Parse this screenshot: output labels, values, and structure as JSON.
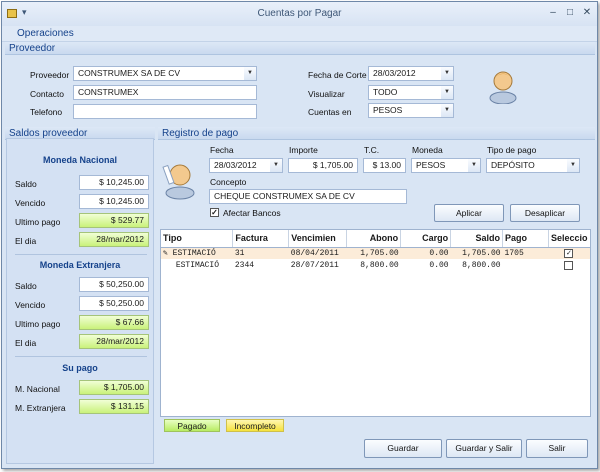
{
  "window": {
    "title": "Cuentas por Pagar"
  },
  "menu": {
    "operaciones": "Operaciones"
  },
  "proveedor": {
    "header": "Proveedor",
    "proveedor_label": "Proveedor",
    "proveedor_value": "CONSTRUMEX SA DE CV",
    "contacto_label": "Contacto",
    "contacto_value": "CONSTRUMEX",
    "telefono_label": "Telefono",
    "telefono_value": "",
    "fecha_corte_label": "Fecha de Corte",
    "fecha_corte_value": "28/03/2012",
    "visualizar_label": "Visualizar",
    "visualizar_value": "TODO",
    "cuentas_en_label": "Cuentas en",
    "cuentas_en_value": "PESOS"
  },
  "saldos": {
    "header": "Saldos proveedor",
    "moneda_nacional": {
      "title": "Moneda Nacional",
      "saldo_label": "Saldo",
      "saldo": "$ 10,245.00",
      "vencido_label": "Vencido",
      "vencido": "$ 10,245.00",
      "ultimo_pago_label": "Ultimo pago",
      "ultimo_pago": "$ 529.77",
      "el_dia_label": "El dia",
      "el_dia": "28/mar/2012"
    },
    "moneda_extranjera": {
      "title": "Moneda Extranjera",
      "saldo_label": "Saldo",
      "saldo": "$ 50,250.00",
      "vencido_label": "Vencido",
      "vencido": "$ 50,250.00",
      "ultimo_pago_label": "Ultimo pago",
      "ultimo_pago": "$ 67.66",
      "el_dia_label": "El dia",
      "el_dia": "28/mar/2012"
    },
    "su_pago": {
      "title": "Su pago",
      "nacional_label": "M. Nacional",
      "nacional": "$ 1,705.00",
      "extranjera_label": "M. Extranjera",
      "extranjera": "$ 131.15"
    }
  },
  "registro": {
    "header": "Registro de pago",
    "fecha_label": "Fecha",
    "fecha_value": "28/03/2012",
    "importe_label": "Importe",
    "importe_value": "$ 1,705.00",
    "tc_label": "T.C.",
    "tc_value": "$ 13.00",
    "moneda_label": "Moneda",
    "moneda_value": "PESOS",
    "tipo_pago_label": "Tipo de pago",
    "tipo_pago_value": "DEPÓSITO",
    "concepto_label": "Concepto",
    "concepto_value": "CHEQUE CONSTRUMEX SA DE CV",
    "afectar_bancos_label": "Afectar Bancos",
    "aplicar_label": "Aplicar",
    "desaplicar_label": "Desaplicar"
  },
  "grid": {
    "columns": [
      "Tipo",
      "Factura",
      "Vencimien",
      "Abono",
      "Cargo",
      "Saldo",
      "Pago",
      "Seleccio"
    ],
    "rows": [
      {
        "tipo": "ESTIMACIÓ",
        "factura": "31",
        "vencimiento": "08/04/2011",
        "abono": "1,705.00",
        "cargo": "0.00",
        "saldo": "1,705.00",
        "pago": "1705",
        "seleccion": true
      },
      {
        "tipo": "ESTIMACIÓ",
        "factura": "2344",
        "vencimiento": "28/07/2011",
        "abono": "8,800.00",
        "cargo": "0.00",
        "saldo": "8,800.00",
        "pago": "",
        "seleccion": false
      }
    ]
  },
  "legend": {
    "pagado": "Pagado",
    "incompleto": "Incompleto"
  },
  "footer": {
    "guardar": "Guardar",
    "guardar_y_salir": "Guardar y Salir",
    "salir": "Salir"
  }
}
